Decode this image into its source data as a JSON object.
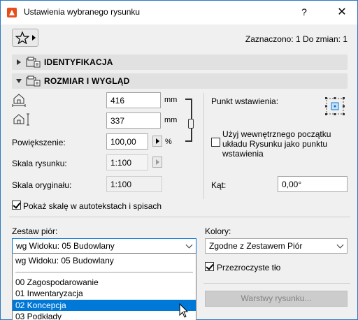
{
  "window": {
    "title": "Ustawienia wybranego rysunku",
    "help_label": "?",
    "close_label": "✕"
  },
  "header": {
    "selection_info": "Zaznaczono: 1 Do zmian: 1"
  },
  "sections": {
    "identification": "IDENTYFIKACJA",
    "size_appearance": "ROZMIAR I WYGLĄD"
  },
  "size": {
    "width_value": "416",
    "width_unit": "mm",
    "height_value": "337",
    "height_unit": "mm",
    "magnification_label": "Powiększenie:",
    "magnification_value": "100,00",
    "magnification_unit": "%",
    "drawing_scale_label": "Skala rysunku:",
    "drawing_scale_value": "1:100",
    "original_scale_label": "Skala oryginału:",
    "original_scale_value": "1:100",
    "show_scale_label": "Pokaż skalę w autotekstach i spisach",
    "show_scale_checked": true
  },
  "insertion": {
    "anchor_label": "Punkt wstawienia:",
    "use_origin_label_1": "Użyj wewnętrznego początku",
    "use_origin_label_2": "układu Rysunku jako punktu",
    "use_origin_label_3": "wstawienia",
    "use_origin_checked": false,
    "angle_label": "Kąt:",
    "angle_value": "0,00°"
  },
  "pens": {
    "pen_set_label": "Zestaw piór:",
    "pen_set_value": "wg Widoku: 05 Budowlany",
    "options": [
      "wg Widoku: 05 Budowlany",
      "00 Zagospodarowanie",
      "01 Inwentaryzacja",
      "02 Koncepcja",
      "03 Podkłady"
    ],
    "highlighted_option": "02 Koncepcja"
  },
  "colors": {
    "colors_label": "Kolory:",
    "colors_value": "Zgodne z Zestawem Piór",
    "transparent_label": "Przezroczyste tło",
    "transparent_checked": true,
    "layers_button": "Warstwy rysunku..."
  },
  "icons": {
    "app": "archicad-icon",
    "favorites": "star-icon",
    "section": "drawing-icon"
  },
  "theme": {
    "highlight": "#0078d7",
    "section_bg": "#e1e1e1",
    "window_bg": "#f0f0f0"
  }
}
